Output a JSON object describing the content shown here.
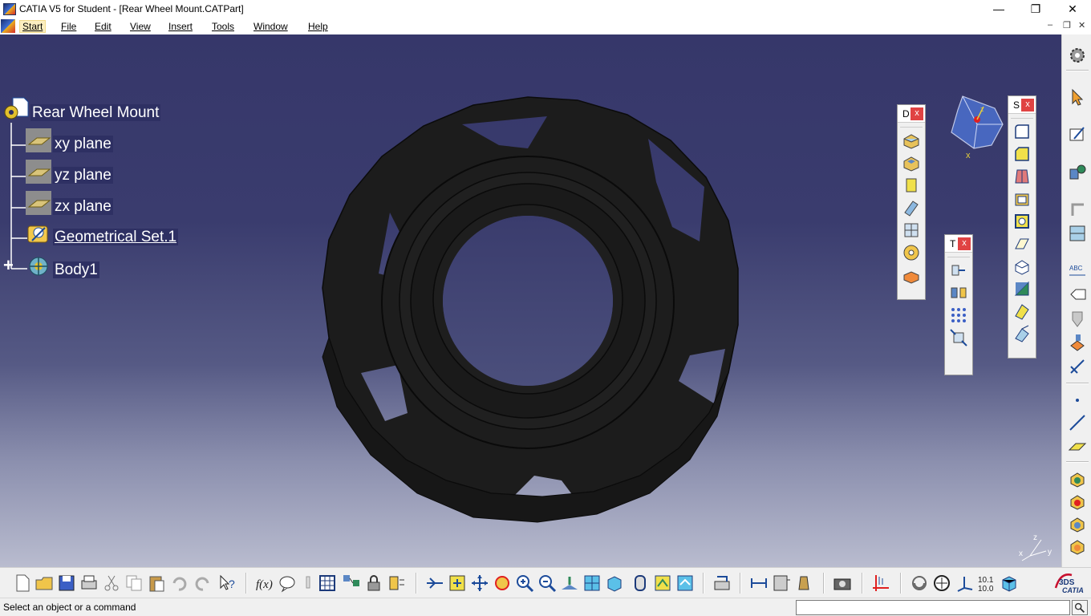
{
  "window": {
    "title": "CATIA V5 for Student - [Rear Wheel Mount.CATPart]",
    "minimize": "—",
    "maximize": "❐",
    "close": "✕"
  },
  "menu": {
    "items": [
      {
        "label": "Start",
        "active": true
      },
      {
        "label": "File"
      },
      {
        "label": "Edit"
      },
      {
        "label": "View"
      },
      {
        "label": "Insert"
      },
      {
        "label": "Tools"
      },
      {
        "label": "Window"
      },
      {
        "label": "Help"
      }
    ],
    "mdi_min": "–",
    "mdi_restore": "❐",
    "mdi_close": "✕"
  },
  "tree": {
    "root": "Rear Wheel Mount",
    "children": [
      {
        "label": "xy plane",
        "icon": "plane-icon"
      },
      {
        "label": "yz plane",
        "icon": "plane-icon"
      },
      {
        "label": "zx plane",
        "icon": "plane-icon"
      },
      {
        "label": "Geometrical Set.1",
        "icon": "geometrical-set-icon",
        "underlined": true
      },
      {
        "label": "Body1",
        "icon": "body-icon",
        "expand": "+"
      }
    ]
  },
  "compass": {
    "x_label": "x",
    "z_label": "z"
  },
  "axis_triad": {
    "x": "x",
    "y": "y",
    "z": "z"
  },
  "floating_toolbars": [
    {
      "id": "D",
      "title": "D",
      "close": "x"
    },
    {
      "id": "T",
      "title": "T",
      "close": "x"
    },
    {
      "id": "S",
      "title": "S",
      "close": "x"
    }
  ],
  "colors": {
    "viewport_top": "#36376a",
    "viewport_bottom": "#b9bccf",
    "part": "#1c1c1c",
    "close_red": "#e04343"
  },
  "statusbar": {
    "message": "Select an object or a command",
    "input_value": ""
  },
  "logo": {
    "text": "CATIA"
  }
}
